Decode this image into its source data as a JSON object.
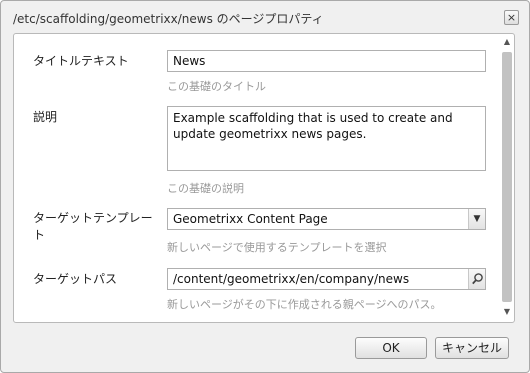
{
  "dialog": {
    "title": "/etc/scaffolding/geometrixx/news のページプロパティ",
    "close_label": "×"
  },
  "form": {
    "title_label": "タイトルテキスト",
    "title_value": "News",
    "title_hint": "この基礎のタイトル",
    "description_label": "説明",
    "description_value": "Example scaffolding that is used to create and update geometrixx news pages.",
    "description_hint": "この基礎の説明",
    "template_label": "ターゲットテンプレート",
    "template_value": "Geometrixx Content Page",
    "template_hint": "新しいページで使用するテンプレートを選択",
    "path_label": "ターゲットパス",
    "path_value": "/content/geometrixx/en/company/news",
    "path_hint": "新しいページがその下に作成される親ページへのパス。"
  },
  "icons": {
    "dropdown": "chevron-down-icon",
    "search": "search-icon",
    "scroll_up": "scroll-up-arrow-icon",
    "scroll_down": "scroll-down-arrow-icon"
  },
  "buttons": {
    "ok_label": "OK",
    "cancel_label": "キャンセル"
  }
}
